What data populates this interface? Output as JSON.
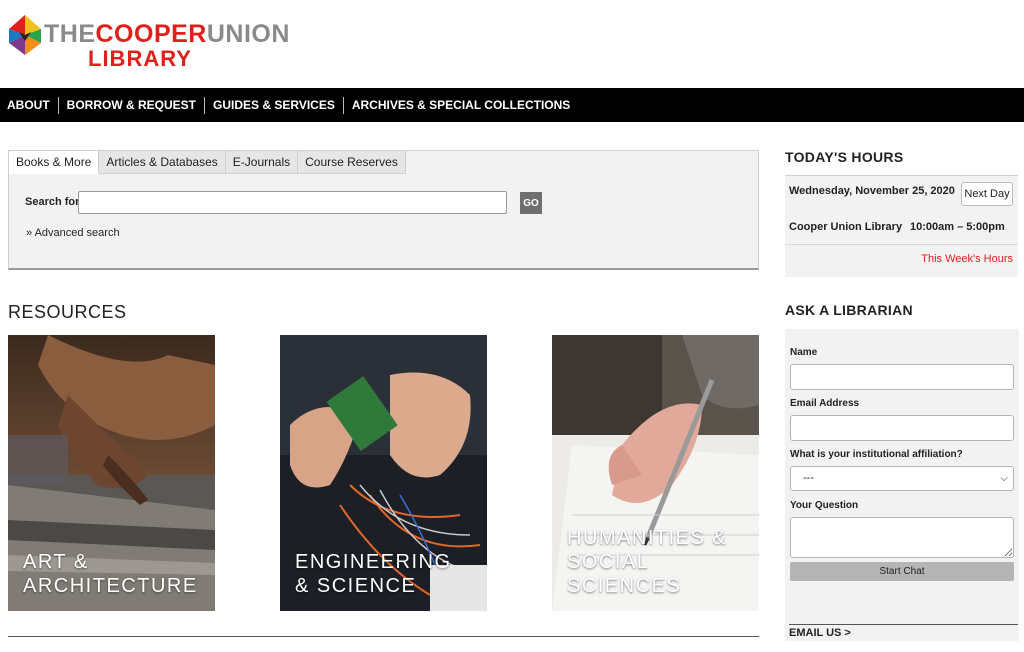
{
  "logo": {
    "line1_gray_a": "THE",
    "line1_red": "COOPER",
    "line1_gray_b": "UNION",
    "line2": "LIBRARY"
  },
  "nav": {
    "items": [
      {
        "label": "ABOUT"
      },
      {
        "label": "BORROW & REQUEST"
      },
      {
        "label": "GUIDES & SERVICES"
      },
      {
        "label": "ARCHIVES & SPECIAL COLLECTIONS"
      }
    ]
  },
  "search": {
    "tabs": [
      {
        "label": "Books & More",
        "active": true
      },
      {
        "label": "Articles & Databases"
      },
      {
        "label": "E-Journals"
      },
      {
        "label": "Course Reserves"
      }
    ],
    "label": "Search for",
    "value": "",
    "go_label": "GO",
    "advanced_label": "» Advanced search"
  },
  "resources": {
    "title": "RESOURCES",
    "cards": [
      {
        "line1": "ART &",
        "line2": "ARCHITECTURE"
      },
      {
        "line1": "ENGINEERING",
        "line2": "& SCIENCE"
      },
      {
        "line1": "HUMANITIES &",
        "line2": "SOCIAL SCIENCES"
      }
    ]
  },
  "hours": {
    "title": "TODAY'S HOURS",
    "date": "Wednesday, November 25, 2020",
    "next_day_label": "Next Day",
    "library": "Cooper Union Library",
    "time": "10:00am – 5:00pm",
    "week_link": "This Week's Hours"
  },
  "ask": {
    "title": "ASK A LIBRARIAN",
    "name_label": "Name",
    "email_label": "Email Address",
    "affiliation_label": "What is your institutional affiliation?",
    "affiliation_value": "---",
    "question_label": "Your Question",
    "start_chat_label": "Start Chat",
    "email_us_label": "EMAIL US >"
  },
  "colors": {
    "brand_red": "#e0201b",
    "nav_bg": "#000000",
    "panel_bg": "#f2f2f2"
  }
}
